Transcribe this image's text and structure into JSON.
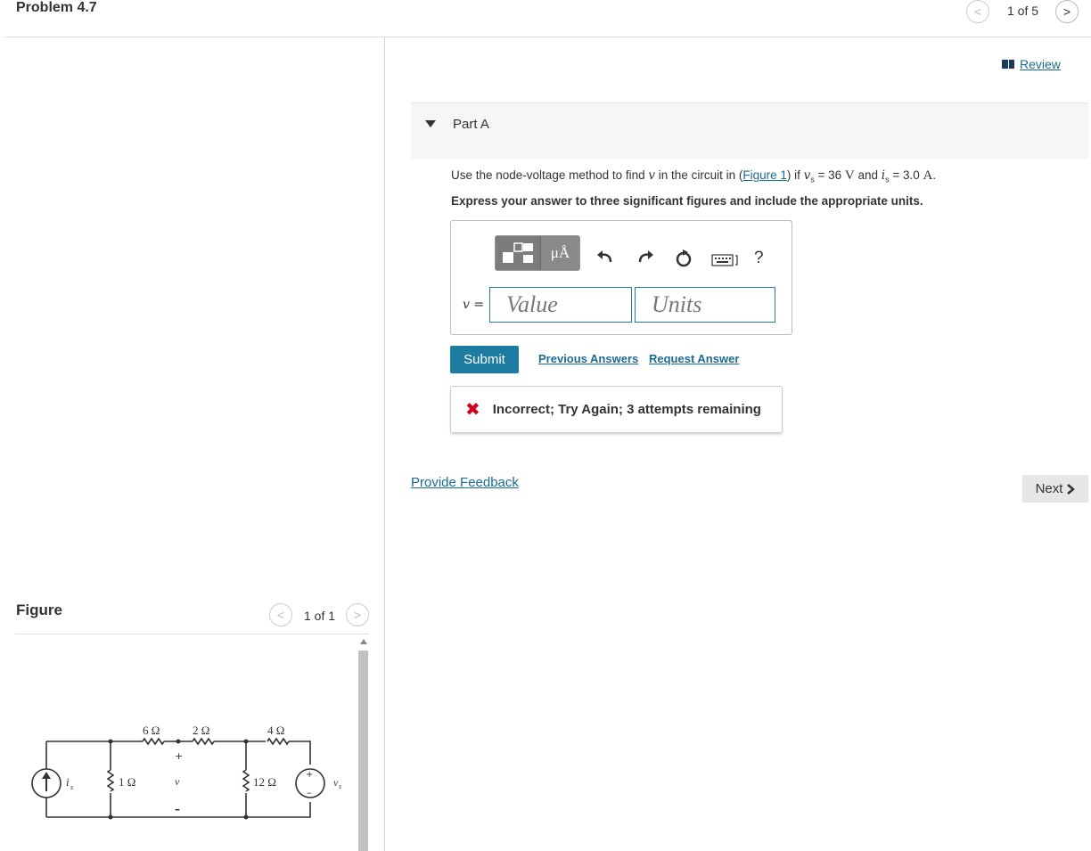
{
  "header": {
    "title": "Problem 4.7",
    "pager": "1 of 5",
    "review_label": "Review"
  },
  "part": {
    "label": "Part A",
    "question": {
      "intro": "Use the node-voltage method to find ",
      "var_v": "v",
      "mid1": " in the circuit in (",
      "figure_link": "Figure 1",
      "mid2": ") if ",
      "vs_sym": "v",
      "vs_sub": "s",
      "vs_eq": " = 36 ",
      "vs_unit": "V",
      "and": " and ",
      "is_sym": "i",
      "is_sub": "s",
      "is_eq": " = 3.0 ",
      "is_unit": "A",
      "end": "."
    },
    "instruction": "Express your answer to three significant figures and include the appropriate units.",
    "answer": {
      "variable_label": "v =",
      "value_placeholder": "Value",
      "units_placeholder": "Units",
      "units_button": "μÅ",
      "help_label": "?"
    },
    "submit_label": "Submit",
    "previous_answers_label": "Previous Answers",
    "request_answer_label": "Request Answer",
    "feedback_text": "Incorrect; Try Again; 3 attempts remaining"
  },
  "provide_feedback_label": "Provide Feedback",
  "next_label": "Next",
  "figure": {
    "title": "Figure",
    "pager": "1 of 1",
    "circuit": {
      "r6": "6 Ω",
      "r2": "2 Ω",
      "r4": "4 Ω",
      "r1": "1 Ω",
      "r12": "12 Ω",
      "v_label": "v",
      "plus": "+",
      "minus": "–",
      "is_label": "i",
      "is_sub": "s",
      "vs_label": "v",
      "vs_sub": "s"
    }
  },
  "colors": {
    "link": "#1b6b93",
    "submit": "#1c7ba0",
    "error": "#d0021b"
  }
}
